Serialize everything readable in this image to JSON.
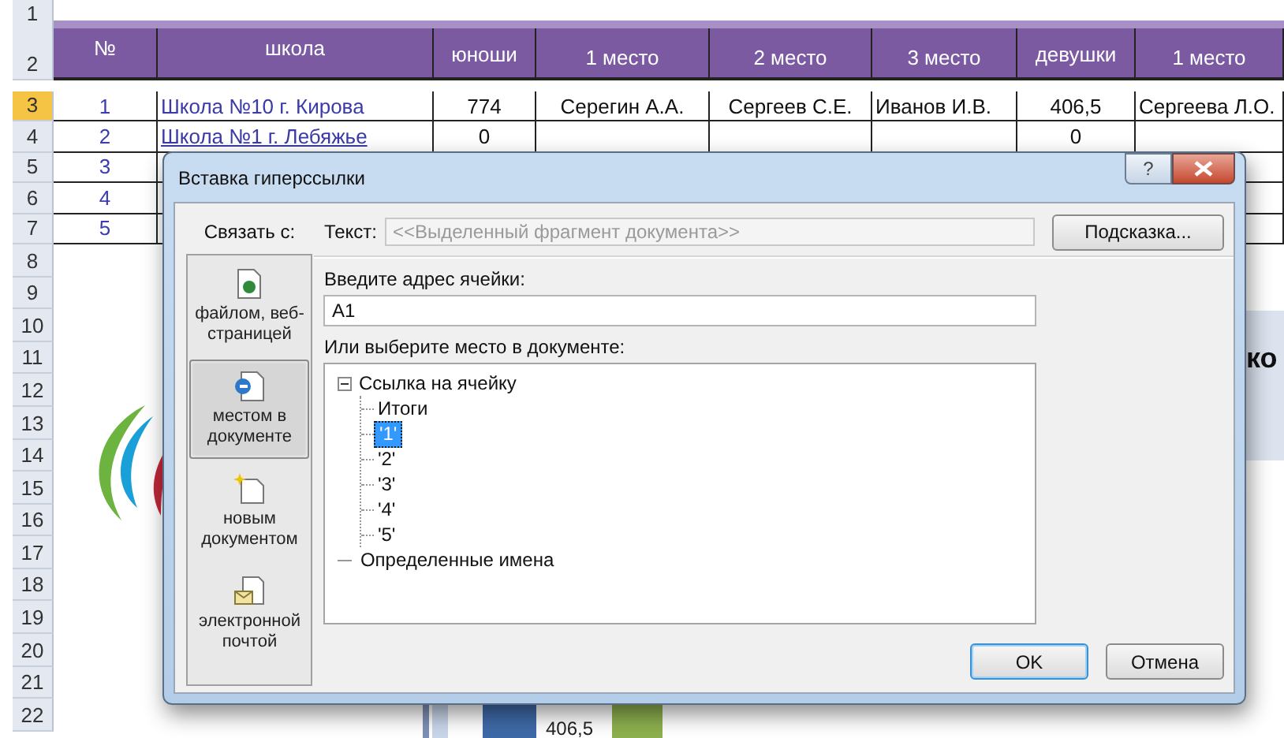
{
  "sheet": {
    "row_numbers": [
      {
        "label": "1",
        "selected": false
      },
      {
        "label": "2",
        "selected": false
      },
      {
        "label": "3",
        "selected": true
      },
      {
        "label": "4",
        "selected": false
      },
      {
        "label": "5",
        "selected": false
      },
      {
        "label": "6",
        "selected": false
      },
      {
        "label": "7",
        "selected": false
      },
      {
        "label": "8",
        "selected": false
      },
      {
        "label": "9",
        "selected": false
      },
      {
        "label": "10",
        "selected": false
      },
      {
        "label": "11",
        "selected": false
      },
      {
        "label": "12",
        "selected": false
      },
      {
        "label": "13",
        "selected": false
      },
      {
        "label": "14",
        "selected": false
      },
      {
        "label": "15",
        "selected": false
      },
      {
        "label": "16",
        "selected": false
      },
      {
        "label": "17",
        "selected": false
      },
      {
        "label": "18",
        "selected": false
      },
      {
        "label": "19",
        "selected": false
      },
      {
        "label": "20",
        "selected": false
      },
      {
        "label": "21",
        "selected": false
      },
      {
        "label": "22",
        "selected": false
      }
    ],
    "columns": [
      {
        "label": "№",
        "kind": "main"
      },
      {
        "label": "школа",
        "kind": "main"
      },
      {
        "label": "юноши",
        "kind": "group"
      },
      {
        "label": "1 место",
        "kind": "sub"
      },
      {
        "label": "2 место",
        "kind": "sub"
      },
      {
        "label": "3 место",
        "kind": "sub"
      },
      {
        "label": "девушки",
        "kind": "group"
      },
      {
        "label": "1 место",
        "kind": "sub"
      }
    ],
    "rows": [
      {
        "number": "1",
        "school": {
          "text": "Школа №10 г. Кирова",
          "underlined": false
        },
        "boys": "774",
        "boys_place_1": "Серегин А.А.",
        "boys_place_2": "Сергеев С.Е.",
        "boys_place_3": "Иванов И.В.",
        "girls": "406,5",
        "girls_place_1": "Сергеева Л.О."
      },
      {
        "number": "2",
        "school": {
          "text": "Школа №1 г. Лебяжье",
          "underlined": true
        },
        "boys": "0",
        "girls": "0"
      },
      {
        "number": "3"
      },
      {
        "number": "4"
      },
      {
        "number": "5"
      }
    ]
  },
  "background": {
    "chart_label": "406,5",
    "panel_text": "ко"
  },
  "dialog": {
    "title": "Вставка гиперссылки",
    "help_button": "?",
    "link_to_label": "Связать с:",
    "link_targets": [
      {
        "label": "файлом, веб-страницей",
        "kind": "file",
        "selected": false
      },
      {
        "label": "местом в документе",
        "kind": "place",
        "selected": true
      },
      {
        "label": "новым документом",
        "kind": "new",
        "selected": false
      },
      {
        "label": "электронной почтой",
        "kind": "email",
        "selected": false
      }
    ],
    "text_label": "Текст:",
    "text_value": "<<Выделенный фрагмент документа>>",
    "tip_button": "Подсказка...",
    "address_label": "Введите адрес ячейки:",
    "address_value": "A1",
    "place_label": "Или выберите место в документе:",
    "tree": [
      {
        "label": "Ссылка на ячейку",
        "expanded": true,
        "selected": false,
        "children": [
          {
            "label": "Итоги",
            "selected": false
          },
          {
            "label": "'1'",
            "selected": true
          },
          {
            "label": "'2'",
            "selected": false
          },
          {
            "label": "'3'",
            "selected": false
          },
          {
            "label": "'4'",
            "selected": false
          },
          {
            "label": "'5'",
            "selected": false
          }
        ]
      },
      {
        "label": "Определенные имена",
        "selected": false
      }
    ],
    "buttons": [
      "OK",
      "Отмена"
    ]
  }
}
